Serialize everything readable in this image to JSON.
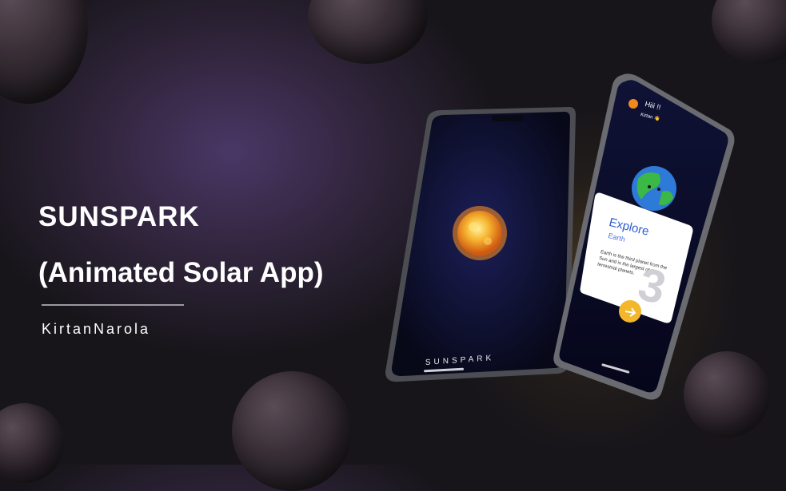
{
  "headline": {
    "title": "SUNSPARK",
    "subtitle": "(Animated Solar App)",
    "author": "KirtanNarola"
  },
  "phone_left": {
    "splash_label": "SUNSPARK"
  },
  "phone_right": {
    "greeting": "Hiii !!",
    "user_name": "Kirtan 👋",
    "card": {
      "title": "Explore",
      "subtitle": "Earth",
      "description": "Earth is the third planet from the Sun and is the largest of the terrestrial planets.",
      "number": "3"
    }
  },
  "colors": {
    "accent_blue": "#2e5fd0",
    "sun_orange": "#f5a623",
    "button_yellow": "#f4b62a"
  }
}
